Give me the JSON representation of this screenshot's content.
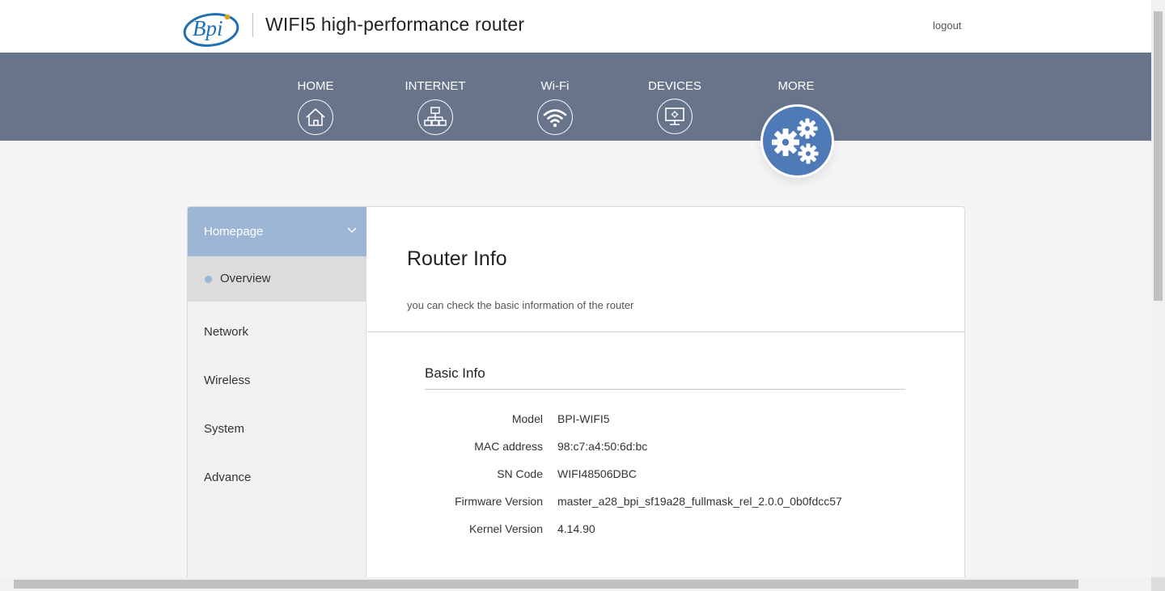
{
  "header": {
    "logo_text": "Bpi",
    "title": "WIFI5 high-performance router",
    "logout_label": "logout"
  },
  "nav": {
    "items": [
      {
        "label": "HOME",
        "icon": "home-icon"
      },
      {
        "label": "INTERNET",
        "icon": "network-icon"
      },
      {
        "label": "Wi-Fi",
        "icon": "wifi-icon"
      },
      {
        "label": "DEVICES",
        "icon": "devices-icon"
      },
      {
        "label": "MORE",
        "icon": "gears-icon",
        "active": true
      }
    ],
    "bar_color": "#67748a",
    "active_color": "#4e7ab8"
  },
  "sidebar": {
    "section": {
      "label": "Homepage",
      "expanded": true
    },
    "subitems": [
      {
        "label": "Overview",
        "active": true
      }
    ],
    "items": [
      {
        "label": "Network"
      },
      {
        "label": "Wireless"
      },
      {
        "label": "System"
      },
      {
        "label": "Advance"
      }
    ],
    "accent_color": "#9db6d6"
  },
  "main": {
    "title": "Router Info",
    "subtitle": "you can check the basic information of the router",
    "section_title": "Basic Info",
    "rows": [
      {
        "label": "Model",
        "value": "BPI-WIFI5"
      },
      {
        "label": "MAC address",
        "value": "98:c7:a4:50:6d:bc"
      },
      {
        "label": "SN Code",
        "value": "WIFI48506DBC"
      },
      {
        "label": "Firmware Version",
        "value": "master_a28_bpi_sf19a28_fullmask_rel_2.0.0_0b0fdcc57"
      },
      {
        "label": "Kernel Version",
        "value": "4.14.90"
      }
    ]
  }
}
